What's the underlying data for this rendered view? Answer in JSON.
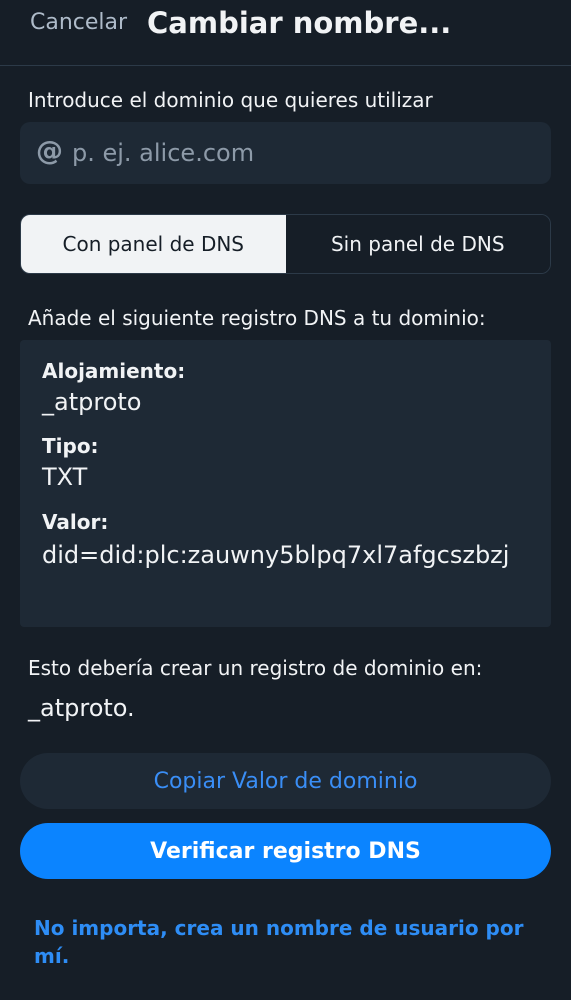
{
  "header": {
    "cancel_label": "Cancelar",
    "title": "Cambiar nombre..."
  },
  "domain": {
    "label": "Introduce el dominio que quieres utilizar",
    "at_symbol": "@",
    "value": "",
    "placeholder": "p. ej. alice.com"
  },
  "tabs": [
    {
      "label": "Con panel de DNS",
      "selected": true
    },
    {
      "label": "Sin panel de DNS",
      "selected": false
    }
  ],
  "record": {
    "intro": "Añade el siguiente registro DNS a tu dominio:",
    "host_label": "Alojamiento:",
    "host_value": "_atproto",
    "type_label": "Tipo:",
    "type_value": "TXT",
    "value_label": "Valor:",
    "value_value": "did=did:plc:zauwny5blpq7xl7afgcszbzj"
  },
  "info": {
    "text": "Esto debería crear un registro de dominio en:",
    "domain": "_atproto."
  },
  "actions": {
    "copy_label": "Copiar Valor de dominio",
    "verify_label": "Verificar registro DNS",
    "fallback_label": "No importa, crea un nombre de usuario por mí."
  },
  "colors": {
    "background": "#161e27",
    "surface": "#1e2935",
    "accent": "#0b84ff",
    "link": "#2e8df5"
  }
}
